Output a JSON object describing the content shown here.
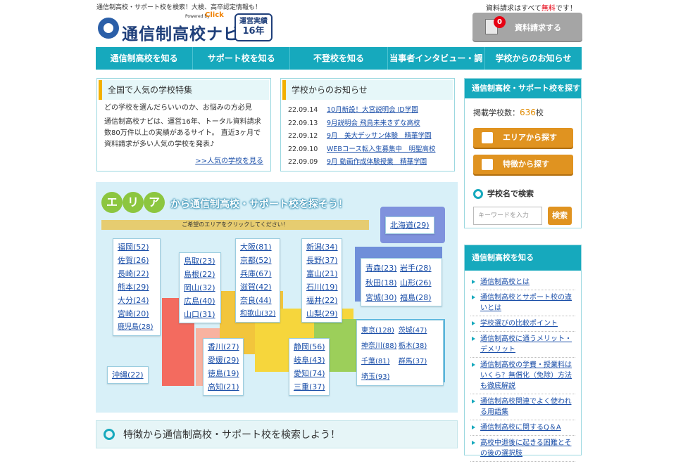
{
  "header": {
    "tagline": "通信制高校・サポート校を検索！大検、高卒認定情報も！",
    "logo_text": "通信制高校ナビ",
    "powered_by": "Powered by",
    "brand": "Click",
    "badge_line1": "運営実績",
    "badge_line2": "16年",
    "free_note_prefix": "資料請求はすべて",
    "free_note_red": "無料",
    "free_note_suffix": "です！",
    "request_count": "0",
    "request_label": "資料請求する"
  },
  "nav": [
    "通信制高校を知る",
    "サポート校を知る",
    "不登校を知る",
    "当事者インタビュー・調査",
    "学校からのお知らせ"
  ],
  "popular": {
    "title": "全国で人気の学校特集",
    "line1": "どの学校を選んだらいいのか、お悩みの方必見",
    "line2": "通信制高校ナビは、運営16年、トータル資料請求数80万件以上の実績があるサイト。 直近3ヶ月で資料請求が多い人気の学校を発表♪",
    "more": ">>人気の学校を見る"
  },
  "news": {
    "title": "学校からのお知らせ",
    "items": [
      {
        "date": "22.09.14",
        "text": "10月新設！大宮説明会 ID学園"
      },
      {
        "date": "22.09.13",
        "text": "9月説明会 飛鳥未来きずな高校"
      },
      {
        "date": "22.09.12",
        "text": "9月　美大デッサン体験　精華学園"
      },
      {
        "date": "22.09.10",
        "text": "WEBコース転入生募集中　明聖高校"
      },
      {
        "date": "22.09.09",
        "text": "9月 動画作成体験授業　精華学園"
      }
    ]
  },
  "side_search": {
    "title": "通信制高校・サポート校を探す",
    "count_label": "掲載学校数：",
    "count": "636",
    "count_unit": "校",
    "area_btn": "エリアから探す",
    "feature_btn": "特徴から探す",
    "name_search": "学校名で検索",
    "placeholder": "キーワードを入力",
    "search_btn": "検索"
  },
  "side_know": {
    "title": "通信制高校を知る",
    "items": [
      "通信制高校とは",
      "通信制高校とサポート校の違いとは",
      "学校選びの比較ポイント",
      "通信制高校に通うメリット・デメリット",
      "通信制高校の学費・授業料はいくら？無償化（免除）方法も徹底解説",
      "通信制高校関連でよく使われる用語集",
      "通信制高校に関するQ＆A",
      "高校中退後に起きる困難とその後の選択肢"
    ]
  },
  "map": {
    "eria": [
      "エ",
      "リ",
      "ア"
    ],
    "title": "から通信制高校・サポート校を探そう！",
    "sub": "ご希望のエリアをクリックしてください！",
    "hokkaido": "北海道(29)",
    "kyushu": [
      "福岡(52)",
      "佐賀(26)",
      "長崎(22)",
      "熊本(29)",
      "大分(24)",
      "宮崎(20)",
      "鹿児島(28)"
    ],
    "okinawa": "沖縄(22)",
    "chugoku": [
      "鳥取(23)",
      "島根(22)",
      "岡山(32)",
      "広島(40)",
      "山口(31)"
    ],
    "shikoku": [
      "香川(27)",
      "愛媛(29)",
      "徳島(19)",
      "高知(21)"
    ],
    "kinki": [
      "大阪(81)",
      "京都(52)",
      "兵庫(67)",
      "滋賀(42)",
      "奈良(44)",
      "和歌山(32)"
    ],
    "hokuriku": [
      "新潟(34)",
      "長野(37)",
      "富山(21)",
      "石川(19)",
      "福井(22)",
      "山梨(29)"
    ],
    "tokai": [
      "静岡(56)",
      "岐阜(43)",
      "愛知(74)",
      "三重(37)"
    ],
    "tohoku": [
      "青森(23)",
      "岩手(28)",
      "秋田(18)",
      "山形(26)",
      "宮城(30)",
      "福島(28)"
    ],
    "kanto": [
      "東京(128)",
      "茨城(47)",
      "神奈川(88)",
      "栃木(38)",
      "千葉(81)",
      "群馬(37)",
      "埼玉(93)"
    ]
  },
  "feature_search": "特徴から通信制高校・サポート校を検索しよう！"
}
